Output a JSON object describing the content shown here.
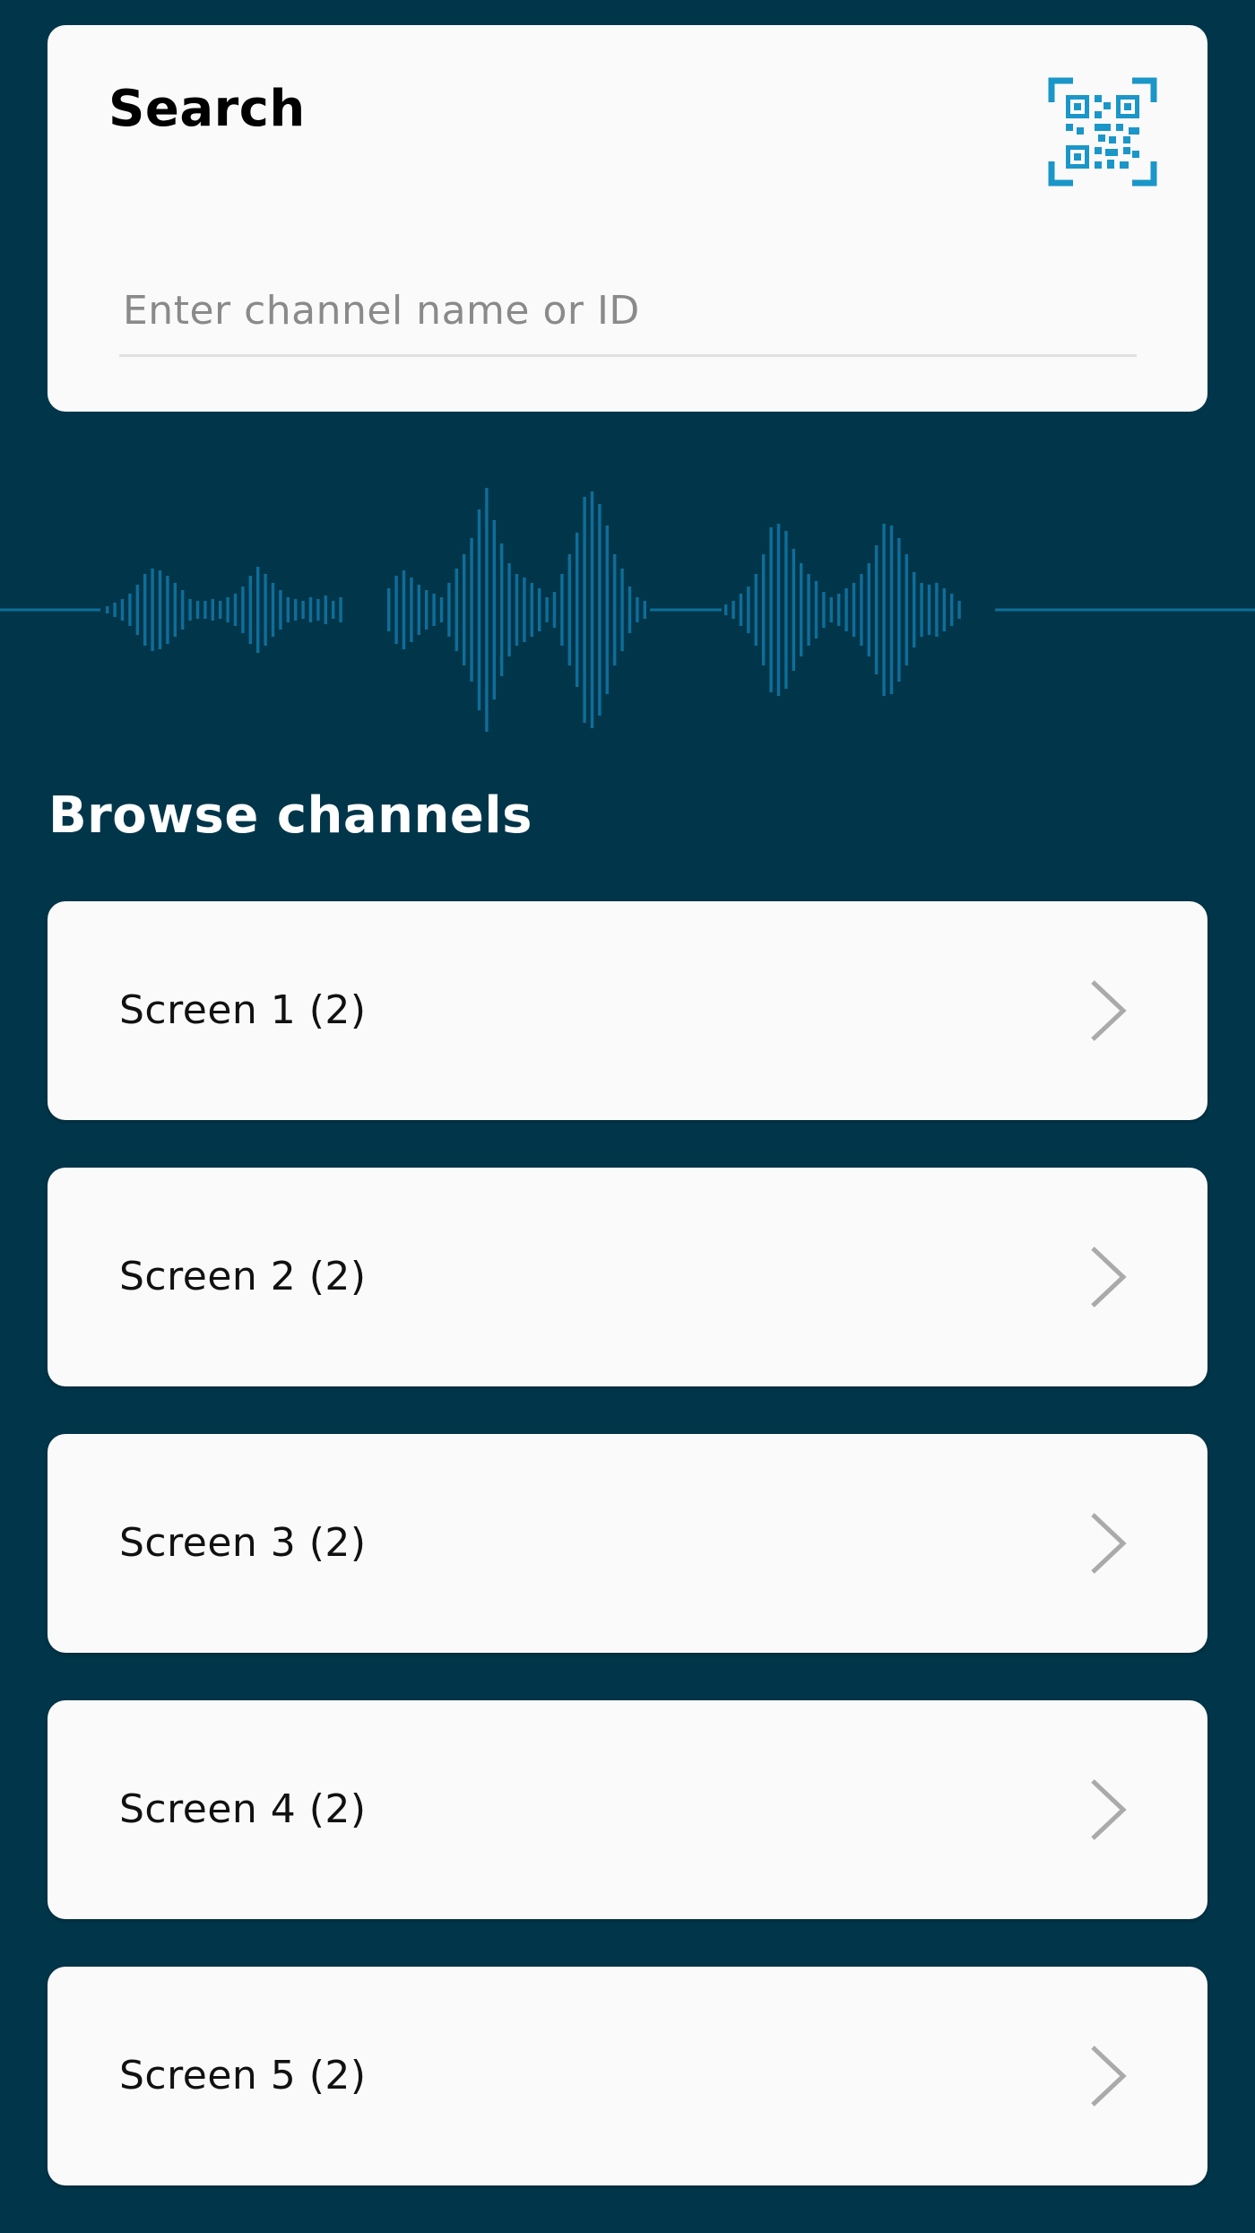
{
  "search": {
    "title": "Search",
    "placeholder": "Enter channel name or ID",
    "value": "",
    "qr_icon": "qr-code-scan-icon",
    "accent_color": "#1B96C8"
  },
  "waveform": {
    "icon": "audio-waveform",
    "color": "#0F6E9A"
  },
  "browse": {
    "title": "Browse channels",
    "channels": [
      {
        "label": "Screen 1 (2)"
      },
      {
        "label": "Screen 2 (2)"
      },
      {
        "label": "Screen 3 (2)"
      },
      {
        "label": "Screen 4 (2)"
      },
      {
        "label": "Screen 5 (2)"
      }
    ]
  },
  "colors": {
    "background": "#01364A",
    "card": "#FAFAFA",
    "chevron": "#AAAAAA"
  }
}
